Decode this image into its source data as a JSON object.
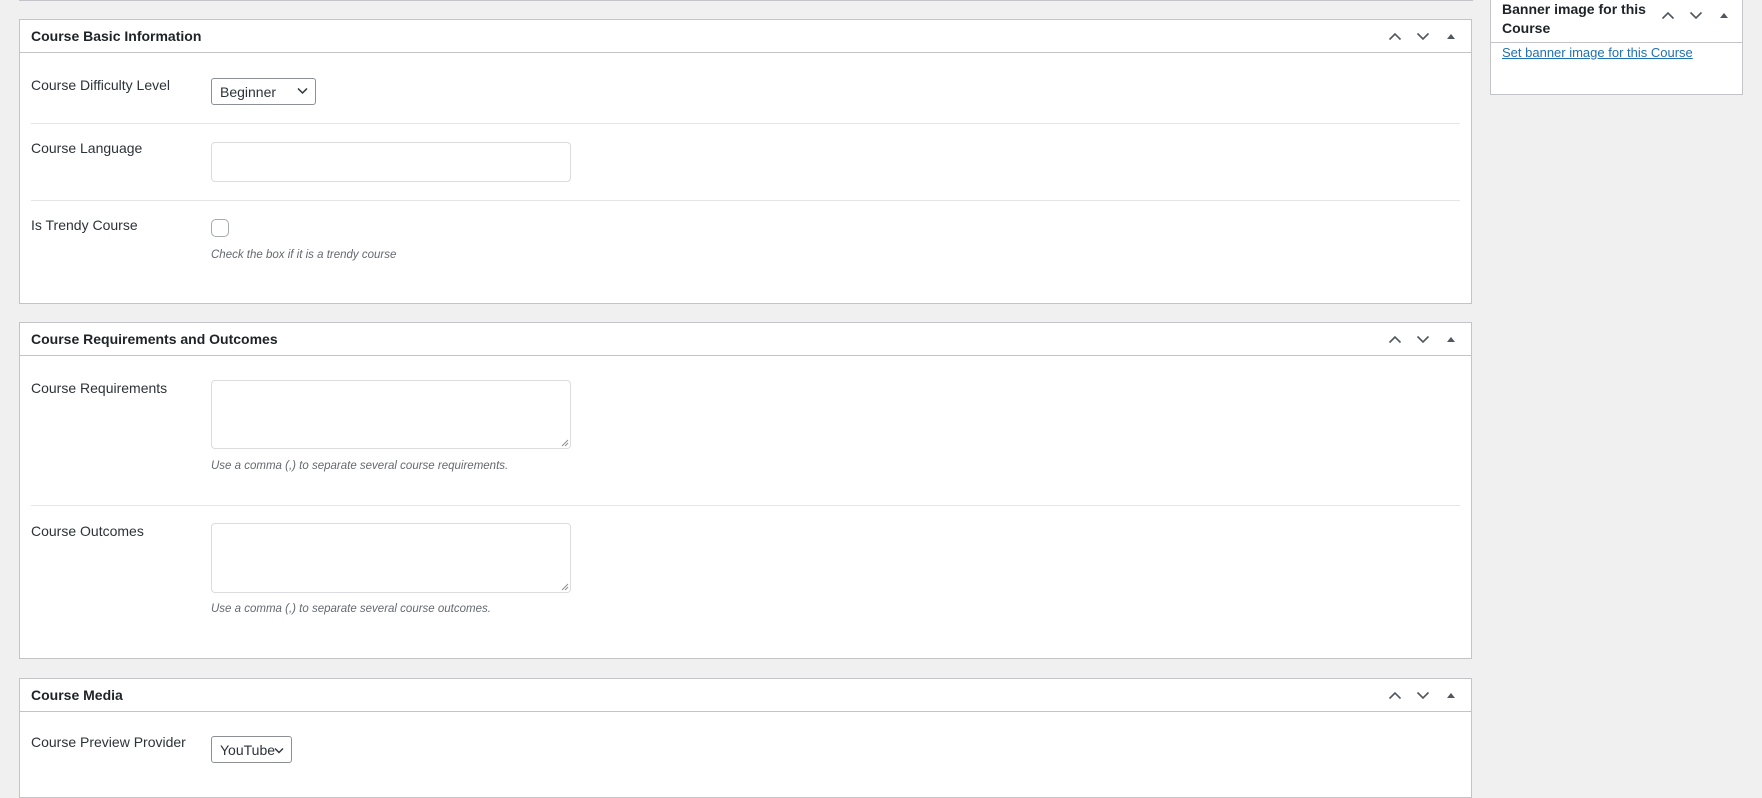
{
  "panels": {
    "basic_info": {
      "title": "Course Basic Information",
      "difficulty": {
        "label": "Course Difficulty Level",
        "selected": "Beginner"
      },
      "language": {
        "label": "Course Language",
        "value": "",
        "placeholder": ""
      },
      "trendy": {
        "label": "Is Trendy Course",
        "checked": false,
        "description": "Check the box if it is a trendy course"
      }
    },
    "requirements_outcomes": {
      "title": "Course Requirements and Outcomes",
      "requirements": {
        "label": "Course Requirements",
        "value": "",
        "description": "Use a comma (,) to separate several course requirements."
      },
      "outcomes": {
        "label": "Course Outcomes",
        "value": "",
        "description": "Use a comma (,) to separate several course outcomes."
      }
    },
    "media": {
      "title": "Course Media",
      "preview_provider": {
        "label": "Course Preview Provider",
        "selected": "YouTube"
      }
    }
  },
  "sidebar": {
    "banner": {
      "title": "Banner image for this Course",
      "link": "Set banner image for this Course"
    }
  },
  "handle_icons": [
    "move-up-icon",
    "move-down-icon",
    "toggle-panel-icon"
  ],
  "colors": {
    "link": "#2271b1",
    "background": "#f0f0f1",
    "border": "#c3c4c7"
  }
}
